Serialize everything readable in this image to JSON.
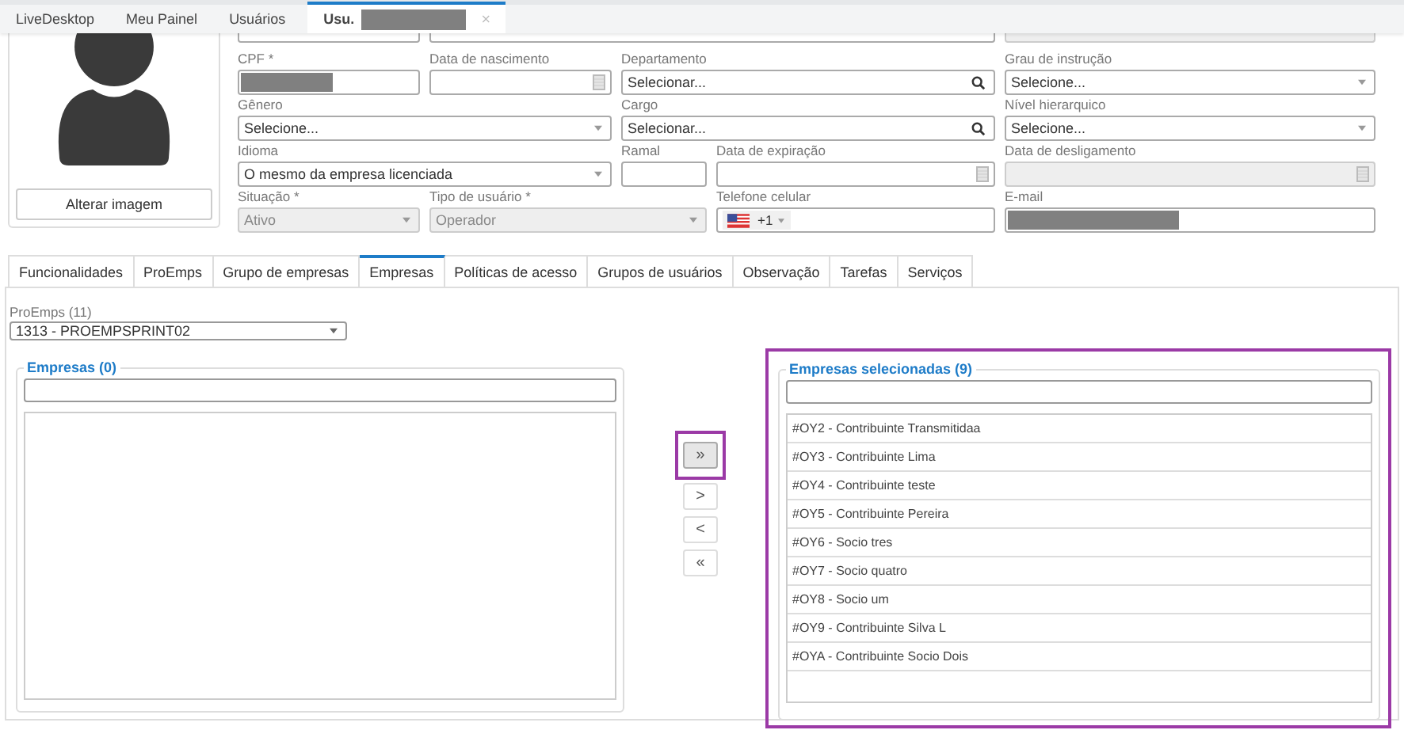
{
  "app_tabs": [
    {
      "label": "LiveDesktop",
      "selected": false
    },
    {
      "label": "Meu Painel",
      "selected": false
    },
    {
      "label": "Usuários",
      "selected": false
    },
    {
      "label": "Usu.",
      "selected": true,
      "closable": true,
      "redacted": true
    }
  ],
  "top_row": [
    {
      "disabled": false
    },
    {
      "disabled": false
    },
    {
      "disabled": true
    }
  ],
  "profile": {
    "button": "Alterar imagem"
  },
  "fields": [
    {
      "kind": "text",
      "label": "CPF *",
      "redacted": true,
      "disabled": false
    },
    {
      "kind": "date",
      "label": "Data de nascimento",
      "disabled": false
    },
    {
      "kind": "search",
      "label": "Departamento",
      "value": "Selecionar...",
      "disabled": false
    },
    {
      "kind": "select",
      "label": "Grau de instrução",
      "value": "Selecione...",
      "disabled": false
    },
    {
      "kind": "select",
      "label": "Gênero",
      "value": "Selecione...",
      "disabled": false
    },
    {
      "kind": "search",
      "label": "Cargo",
      "value": "Selecionar...",
      "disabled": false
    },
    {
      "kind": "select",
      "label": "Nível hierarquico",
      "value": "Selecione...",
      "disabled": false
    },
    {
      "kind": "select",
      "label": "Idioma",
      "value": "O mesmo da empresa licenciada",
      "disabled": false
    },
    {
      "kind": "text",
      "label": "Ramal",
      "disabled": false
    },
    {
      "kind": "date",
      "label": "Data de expiração",
      "disabled": false
    },
    {
      "kind": "date",
      "label": "Data de desligamento",
      "disabled": true
    },
    {
      "kind": "select",
      "label": "Situação *",
      "value": "Ativo",
      "disabled": true
    },
    {
      "kind": "select",
      "label": "Tipo de usuário *",
      "value": "Operador",
      "disabled": true
    },
    {
      "kind": "phone",
      "label": "Telefone celular",
      "value": "+1",
      "disabled": false
    },
    {
      "kind": "text",
      "label": "E-mail",
      "redacted": true,
      "disabled": false
    }
  ],
  "section_tabs": [
    {
      "label": "Funcionalidades",
      "selected": false
    },
    {
      "label": "ProEmps",
      "selected": false
    },
    {
      "label": "Grupo de empresas",
      "selected": false
    },
    {
      "label": "Empresas",
      "selected": true
    },
    {
      "label": "Políticas de acesso",
      "selected": false
    },
    {
      "label": "Grupos de usuários",
      "selected": false
    },
    {
      "label": "Observação",
      "selected": false
    },
    {
      "label": "Tarefas",
      "selected": false
    },
    {
      "label": "Serviços",
      "selected": false
    }
  ],
  "proemps": {
    "label": "ProEmps (11)",
    "value": "1313 - PROEMPSPRINT02"
  },
  "available": {
    "title": "Empresas (0)",
    "highlighted": false
  },
  "move_buttons": [
    {
      "label": "»",
      "highlighted": true
    },
    {
      "label": ">",
      "highlighted": false
    },
    {
      "label": "<",
      "highlighted": false
    },
    {
      "label": "«",
      "highlighted": false
    }
  ],
  "selected_panel": {
    "title": "Empresas selecionadas (9)",
    "highlighted": true,
    "items": [
      "#OY2 - Contribuinte Transmitidaa",
      "#OY3 - Contribuinte Lima",
      "#OY4 - Contribuinte teste",
      "#OY5 - Contribuinte Pereira",
      "#OY6 - Socio tres",
      "#OY7 - Socio quatro",
      "#OY8 - Socio um",
      "#OY9 - Contribuinte Silva L",
      "#OYA - Contribuinte Socio Dois"
    ]
  }
}
